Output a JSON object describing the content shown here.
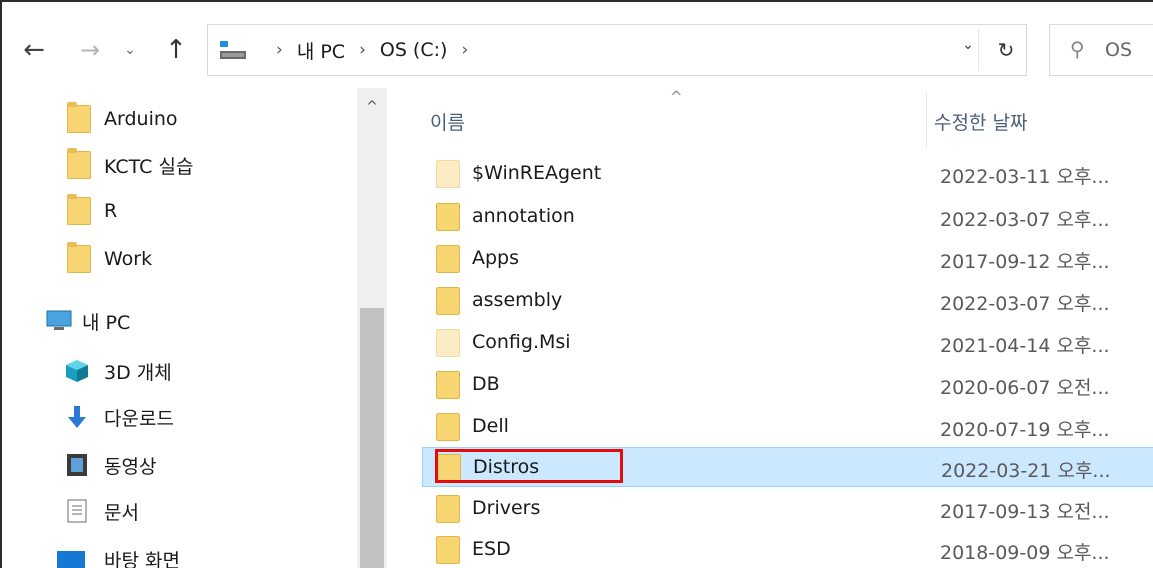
{
  "address_bar": {
    "crumbs": [
      "내 PC",
      "OS (C:)"
    ],
    "search_text": "OS"
  },
  "nav_pane": {
    "items": [
      {
        "label": "Arduino",
        "icon": "folder-icon"
      },
      {
        "label": "KCTC 실습",
        "icon": "folder-icon"
      },
      {
        "label": "R",
        "icon": "folder-icon"
      },
      {
        "label": "Work",
        "icon": "folder-icon"
      },
      {
        "label": "내 PC",
        "icon": "pc-icon"
      },
      {
        "label": "3D 개체",
        "icon": "3d-objects-icon"
      },
      {
        "label": "다운로드",
        "icon": "download-icon"
      },
      {
        "label": "동영상",
        "icon": "video-icon"
      },
      {
        "label": "문서",
        "icon": "document-icon"
      },
      {
        "label": "바탕 화면",
        "icon": "desktop-icon"
      }
    ]
  },
  "file_list": {
    "columns": {
      "name": "이름",
      "date": "수정한 날짜"
    },
    "rows": [
      {
        "name": "$WinREAgent",
        "date": "2022-03-11 오후...",
        "hidden": true
      },
      {
        "name": "annotation",
        "date": "2022-03-07 오후...",
        "hidden": false
      },
      {
        "name": "Apps",
        "date": "2017-09-12 오후...",
        "hidden": false
      },
      {
        "name": "assembly",
        "date": "2022-03-07 오후...",
        "hidden": false
      },
      {
        "name": "Config.Msi",
        "date": "2021-04-14 오후...",
        "hidden": true
      },
      {
        "name": "DB",
        "date": "2020-06-07 오전...",
        "hidden": false
      },
      {
        "name": "Dell",
        "date": "2020-07-19 오후...",
        "hidden": false
      },
      {
        "name": "Distros",
        "date": "2022-03-21 오후...",
        "hidden": false,
        "selected": true
      },
      {
        "name": "Drivers",
        "date": "2017-09-13 오전...",
        "hidden": false
      },
      {
        "name": "ESD",
        "date": "2018-09-09 오후...",
        "hidden": false
      }
    ]
  },
  "colors": {
    "selection_bg": "#cce8ff",
    "highlight_border": "#e30b0b",
    "folder": "#f7d572"
  }
}
